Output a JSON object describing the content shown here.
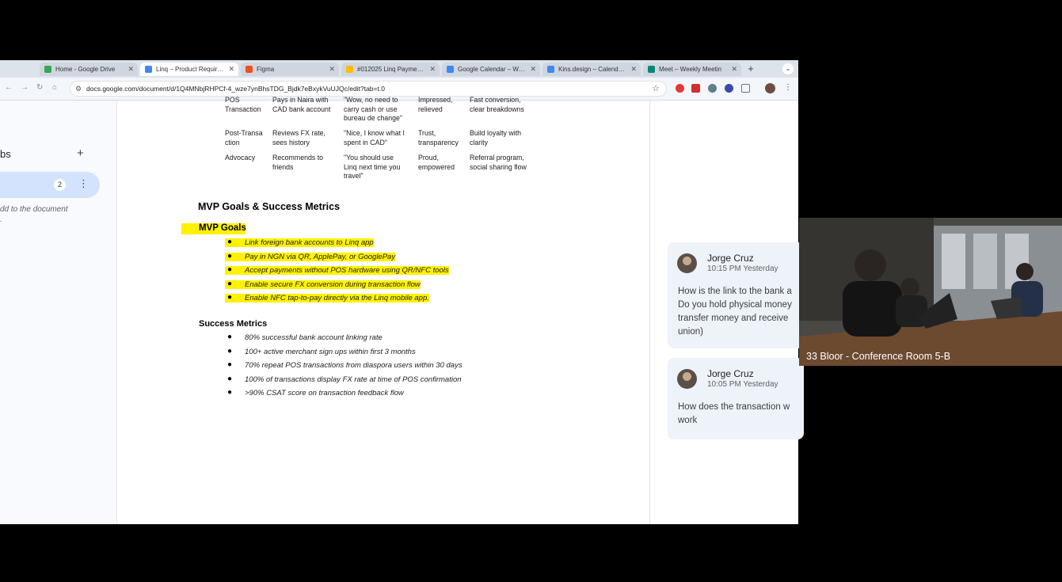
{
  "browser": {
    "tabs": [
      {
        "title": "Home - Google Drive",
        "favicon_color": "#34a853",
        "active": false
      },
      {
        "title": "Linq – Product Requireme",
        "favicon_color": "#4285f4",
        "active": true
      },
      {
        "title": "Figma",
        "favicon_color": "#f24e1e",
        "active": false
      },
      {
        "title": "#012025 Linq Payment –",
        "favicon_color": "#fbbc04",
        "active": false
      },
      {
        "title": "Google Calendar – Week",
        "favicon_color": "#4285f4",
        "active": false
      },
      {
        "title": "Kins.design – Calendar –",
        "favicon_color": "#4285f4",
        "active": false
      },
      {
        "title": "Meet – Weekly Meetin",
        "favicon_color": "#00897b",
        "active": false
      }
    ],
    "new_tab_symbol": "+",
    "url": "docs.google.com/document/d/1Q4MNbjRHPCf-4_wze7ynBhsTDG_Bjdk7eBxykVuUJQc/edit?tab=t.0"
  },
  "sidebar": {
    "heading_partial": "bs",
    "add_symbol": "+",
    "tab_badge": "2",
    "hint_line1": "dd to the document",
    "hint_line2": "."
  },
  "journey_table": [
    {
      "stage": "POS\nTransaction",
      "action": "Pays in Naira with\nCAD bank account",
      "quote": "\"Wow, no need to\ncarry cash or use\nbureau de change\"",
      "emotion": "Impressed,\nrelieved",
      "opportunity": "Fast conversion,\nclear breakdowns"
    },
    {
      "stage": "Post-Transa\nction",
      "action": "Reviews FX rate,\nsees history",
      "quote": "\"Nice, I know what I\nspent in CAD\"",
      "emotion": "Trust,\ntransparency",
      "opportunity": "Build loyalty with\nclarity"
    },
    {
      "stage": "Advocacy",
      "action": "Recommends to\nfriends",
      "quote": "\"You should use\nLinq next time you\ntravel\"",
      "emotion": "Proud,\nempowered",
      "opportunity": "Referral program,\nsocial sharing flow"
    }
  ],
  "doc": {
    "section_title": "MVP Goals & Success Metrics",
    "goals_heading": "MVP Goals",
    "goals": [
      "Link foreign bank accounts to Linq app",
      "Pay in NGN via QR, ApplePay, or GooglePay",
      "Accept payments without POS hardware using QR/NFC tools",
      "Enable secure FX conversion during transaction flow",
      "Enable NFC tap-to-pay directly via the Linq mobile app."
    ],
    "metrics_heading": "Success Metrics",
    "metrics": [
      "80% successful bank account linking rate",
      "100+ active merchant sign ups within first 3 months",
      "70% repeat POS transactions from diaspora users within 30 days",
      "100% of transactions display FX rate at time of POS confirmation",
      ">90% CSAT score on transaction feedback flow"
    ],
    "bullet": "●"
  },
  "comments": [
    {
      "author": "Jorge Cruz",
      "time": "10:15 PM Yesterday",
      "lines": [
        "How is the link to the bank a",
        "Do you hold physical money",
        "transfer money and receive",
        "union)"
      ]
    },
    {
      "author": "Jorge Cruz",
      "time": "10:05 PM Yesterday",
      "lines": [
        "How does the transaction w",
        "work"
      ]
    }
  ],
  "video": {
    "label": "33 Bloor - Conference Room 5-B"
  },
  "colors": {
    "highlight": "#fff200",
    "comment_bg": "#eef2f9"
  }
}
